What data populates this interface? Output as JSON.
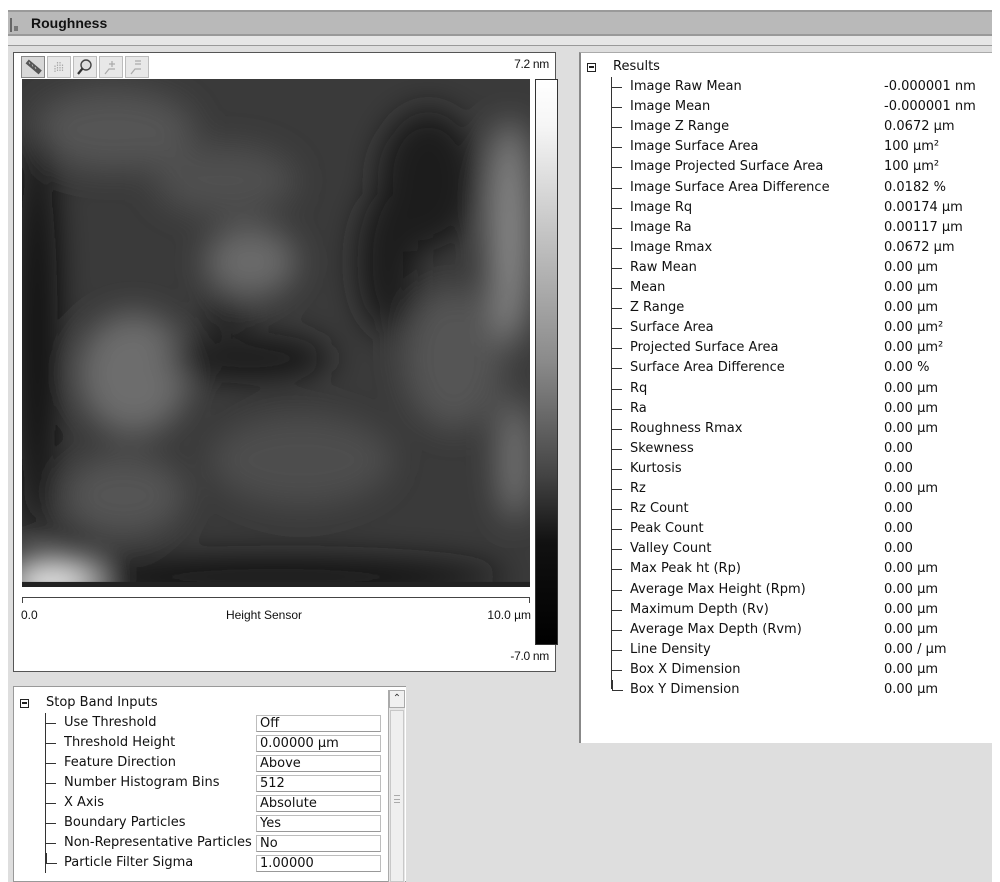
{
  "window": {
    "title": "Roughness",
    "icon": "roughness-app-icon"
  },
  "image_view": {
    "toolbar": [
      {
        "name": "ruler-tool",
        "icon": "ruler-icon",
        "active": true
      },
      {
        "name": "pan-tool",
        "icon": "hand-icon",
        "active": false
      },
      {
        "name": "zoom-tool",
        "icon": "magnifier-icon",
        "active": false
      },
      {
        "name": "zoom-in-tool",
        "icon": "zoom-in-icon",
        "active": false
      },
      {
        "name": "zoom-out-tool",
        "icon": "zoom-out-icon",
        "active": false
      }
    ],
    "scale_max": "7.2 nm",
    "scale_min": "-7.0 nm",
    "x_start": "0.0",
    "x_end": "10.0 µm",
    "channel_label": "Height Sensor"
  },
  "stop_band_inputs": {
    "title": "Stop Band Inputs",
    "rows": [
      {
        "label": "Use Threshold",
        "value": "Off"
      },
      {
        "label": "Threshold Height",
        "value": "0.00000 µm"
      },
      {
        "label": "Feature Direction",
        "value": "Above"
      },
      {
        "label": "Number Histogram Bins",
        "value": "512"
      },
      {
        "label": "X Axis",
        "value": "Absolute"
      },
      {
        "label": "Boundary Particles",
        "value": "Yes"
      },
      {
        "label": "Non-Representative Particles",
        "value": "No"
      },
      {
        "label": "Particle Filter Sigma",
        "value": "1.00000"
      }
    ]
  },
  "results": {
    "title": "Results",
    "rows": [
      {
        "label": "Image Raw Mean",
        "value": "-0.000001 nm"
      },
      {
        "label": "Image Mean",
        "value": "-0.000001 nm"
      },
      {
        "label": "Image Z Range",
        "value": "0.0672 µm"
      },
      {
        "label": "Image Surface Area",
        "value": "100 µm²"
      },
      {
        "label": "Image Projected Surface Area",
        "value": "100 µm²"
      },
      {
        "label": "Image Surface Area Difference",
        "value": "0.0182 %"
      },
      {
        "label": "Image Rq",
        "value": "0.00174 µm"
      },
      {
        "label": "Image Ra",
        "value": "0.00117 µm"
      },
      {
        "label": "Image Rmax",
        "value": "0.0672 µm"
      },
      {
        "label": "Raw Mean",
        "value": "0.00 µm"
      },
      {
        "label": "Mean",
        "value": "0.00 µm"
      },
      {
        "label": "Z Range",
        "value": "0.00 µm"
      },
      {
        "label": "Surface Area",
        "value": "0.00 µm²"
      },
      {
        "label": "Projected Surface Area",
        "value": "0.00 µm²"
      },
      {
        "label": "Surface Area Difference",
        "value": "0.00 %"
      },
      {
        "label": "Rq",
        "value": "0.00 µm"
      },
      {
        "label": "Ra",
        "value": "0.00 µm"
      },
      {
        "label": "Roughness Rmax",
        "value": "0.00 µm"
      },
      {
        "label": "Skewness",
        "value": "0.00"
      },
      {
        "label": "Kurtosis",
        "value": "0.00"
      },
      {
        "label": "Rz",
        "value": "0.00 µm"
      },
      {
        "label": "Rz Count",
        "value": "0.00"
      },
      {
        "label": "Peak Count",
        "value": "0.00"
      },
      {
        "label": "Valley Count",
        "value": "0.00"
      },
      {
        "label": "Max Peak ht (Rp)",
        "value": "0.00 µm"
      },
      {
        "label": "Average Max Height (Rpm)",
        "value": "0.00 µm"
      },
      {
        "label": "Maximum Depth (Rv)",
        "value": "0.00 µm"
      },
      {
        "label": "Average Max Depth (Rvm)",
        "value": "0.00 µm"
      },
      {
        "label": "Line Density",
        "value": "0.00 / µm"
      },
      {
        "label": "Box X Dimension",
        "value": "0.00 µm"
      },
      {
        "label": "Box Y Dimension",
        "value": "0.00 µm"
      }
    ]
  }
}
